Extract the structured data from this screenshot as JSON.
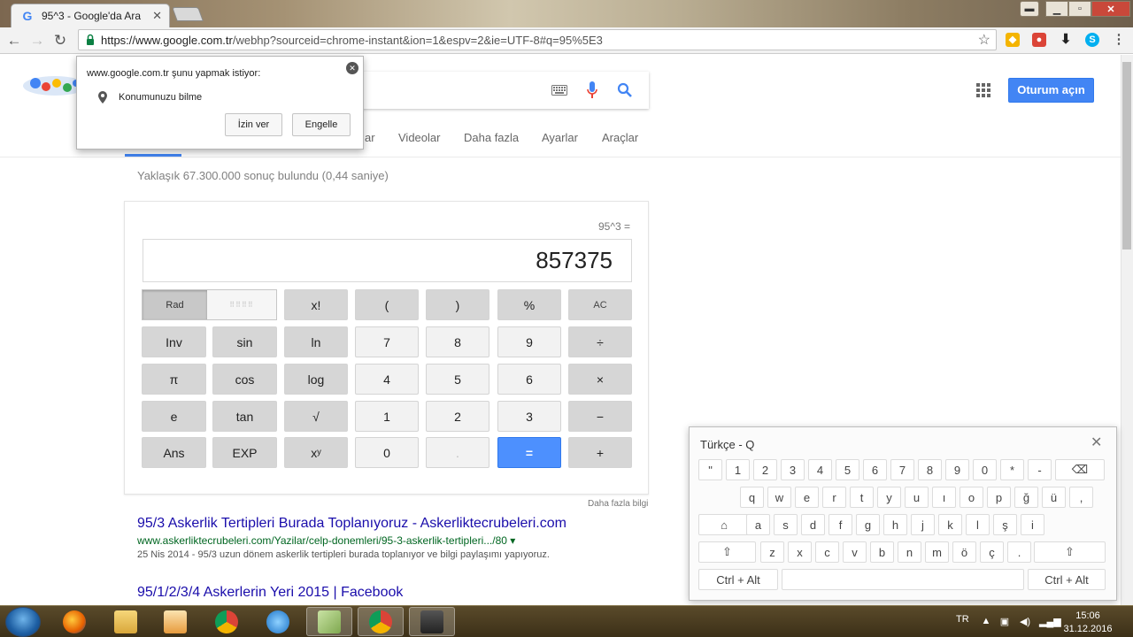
{
  "browser": {
    "tab_title": "95^3 - Google'da Ara",
    "url_scheme_host": "https://www.google.com.tr",
    "url_path": "/webhp?sourceid=chrome-instant&ion=1&espv=2&ie=UTF-8#q=95%5E3",
    "accent": "#4285f4"
  },
  "google": {
    "signin_label": "Oturum açın",
    "nav": {
      "partial": "ar",
      "videos": "Videolar",
      "more": "Daha fazla",
      "settings": "Ayarlar",
      "tools": "Araçlar"
    },
    "result_stats": "Yaklaşık 67.300.000 sonuç bulundu (0,44 saniye)"
  },
  "calculator": {
    "expression": "95^3 =",
    "result": "857375",
    "rad_label": "Rad",
    "more_info": "Daha fazla bilgi",
    "keys": {
      "fact": "x!",
      "lparen": "(",
      "rparen": ")",
      "percent": "%",
      "ac": "AC",
      "inv": "Inv",
      "sin": "sin",
      "ln": "ln",
      "k7": "7",
      "k8": "8",
      "k9": "9",
      "divide": "÷",
      "pi": "π",
      "cos": "cos",
      "log": "log",
      "k4": "4",
      "k5": "5",
      "k6": "6",
      "multiply": "×",
      "e": "e",
      "tan": "tan",
      "sqrt": "√",
      "k1": "1",
      "k2": "2",
      "k3": "3",
      "minus": "−",
      "ans": "Ans",
      "exp": "EXP",
      "pow": "xʸ",
      "k0": "0",
      "dot": ".",
      "equals": "=",
      "plus": "+"
    }
  },
  "results": [
    {
      "title": "95/3 Askerlik Tertipleri Burada Toplanıyoruz - Askerliktecrubeleri.com",
      "url": "www.askerliktecrubeleri.com/Yazilar/celp-donemleri/95-3-askerlik-tertipleri.../80",
      "snippet": "25 Nis 2014 - 95/3 uzun dönem askerlik tertipleri burada toplanıyor ve bilgi paylaşımı yapıyoruz."
    },
    {
      "title": "95/1/2/3/4 Askerlerin Yeri 2015 | Facebook"
    }
  ],
  "permission_popup": {
    "title": "www.google.com.tr şunu yapmak istiyor:",
    "request": "Konumunuzu bilme",
    "allow": "İzin ver",
    "block": "Engelle"
  },
  "keyboard": {
    "title": "Türkçe - Q",
    "row1": [
      "\"",
      "1",
      "2",
      "3",
      "4",
      "5",
      "6",
      "7",
      "8",
      "9",
      "0",
      "*",
      "-"
    ],
    "row2": [
      "q",
      "w",
      "e",
      "r",
      "t",
      "y",
      "u",
      "ı",
      "o",
      "p",
      "ğ",
      "ü",
      ","
    ],
    "row3": [
      "a",
      "s",
      "d",
      "f",
      "g",
      "h",
      "j",
      "k",
      "l",
      "ş",
      "i"
    ],
    "row4": [
      "z",
      "x",
      "c",
      "v",
      "b",
      "n",
      "m",
      "ö",
      "ç",
      "."
    ],
    "ctrl_alt": "Ctrl + Alt"
  },
  "taskbar": {
    "lang": "TR",
    "time": "15:06",
    "date": "31.12.2016"
  }
}
